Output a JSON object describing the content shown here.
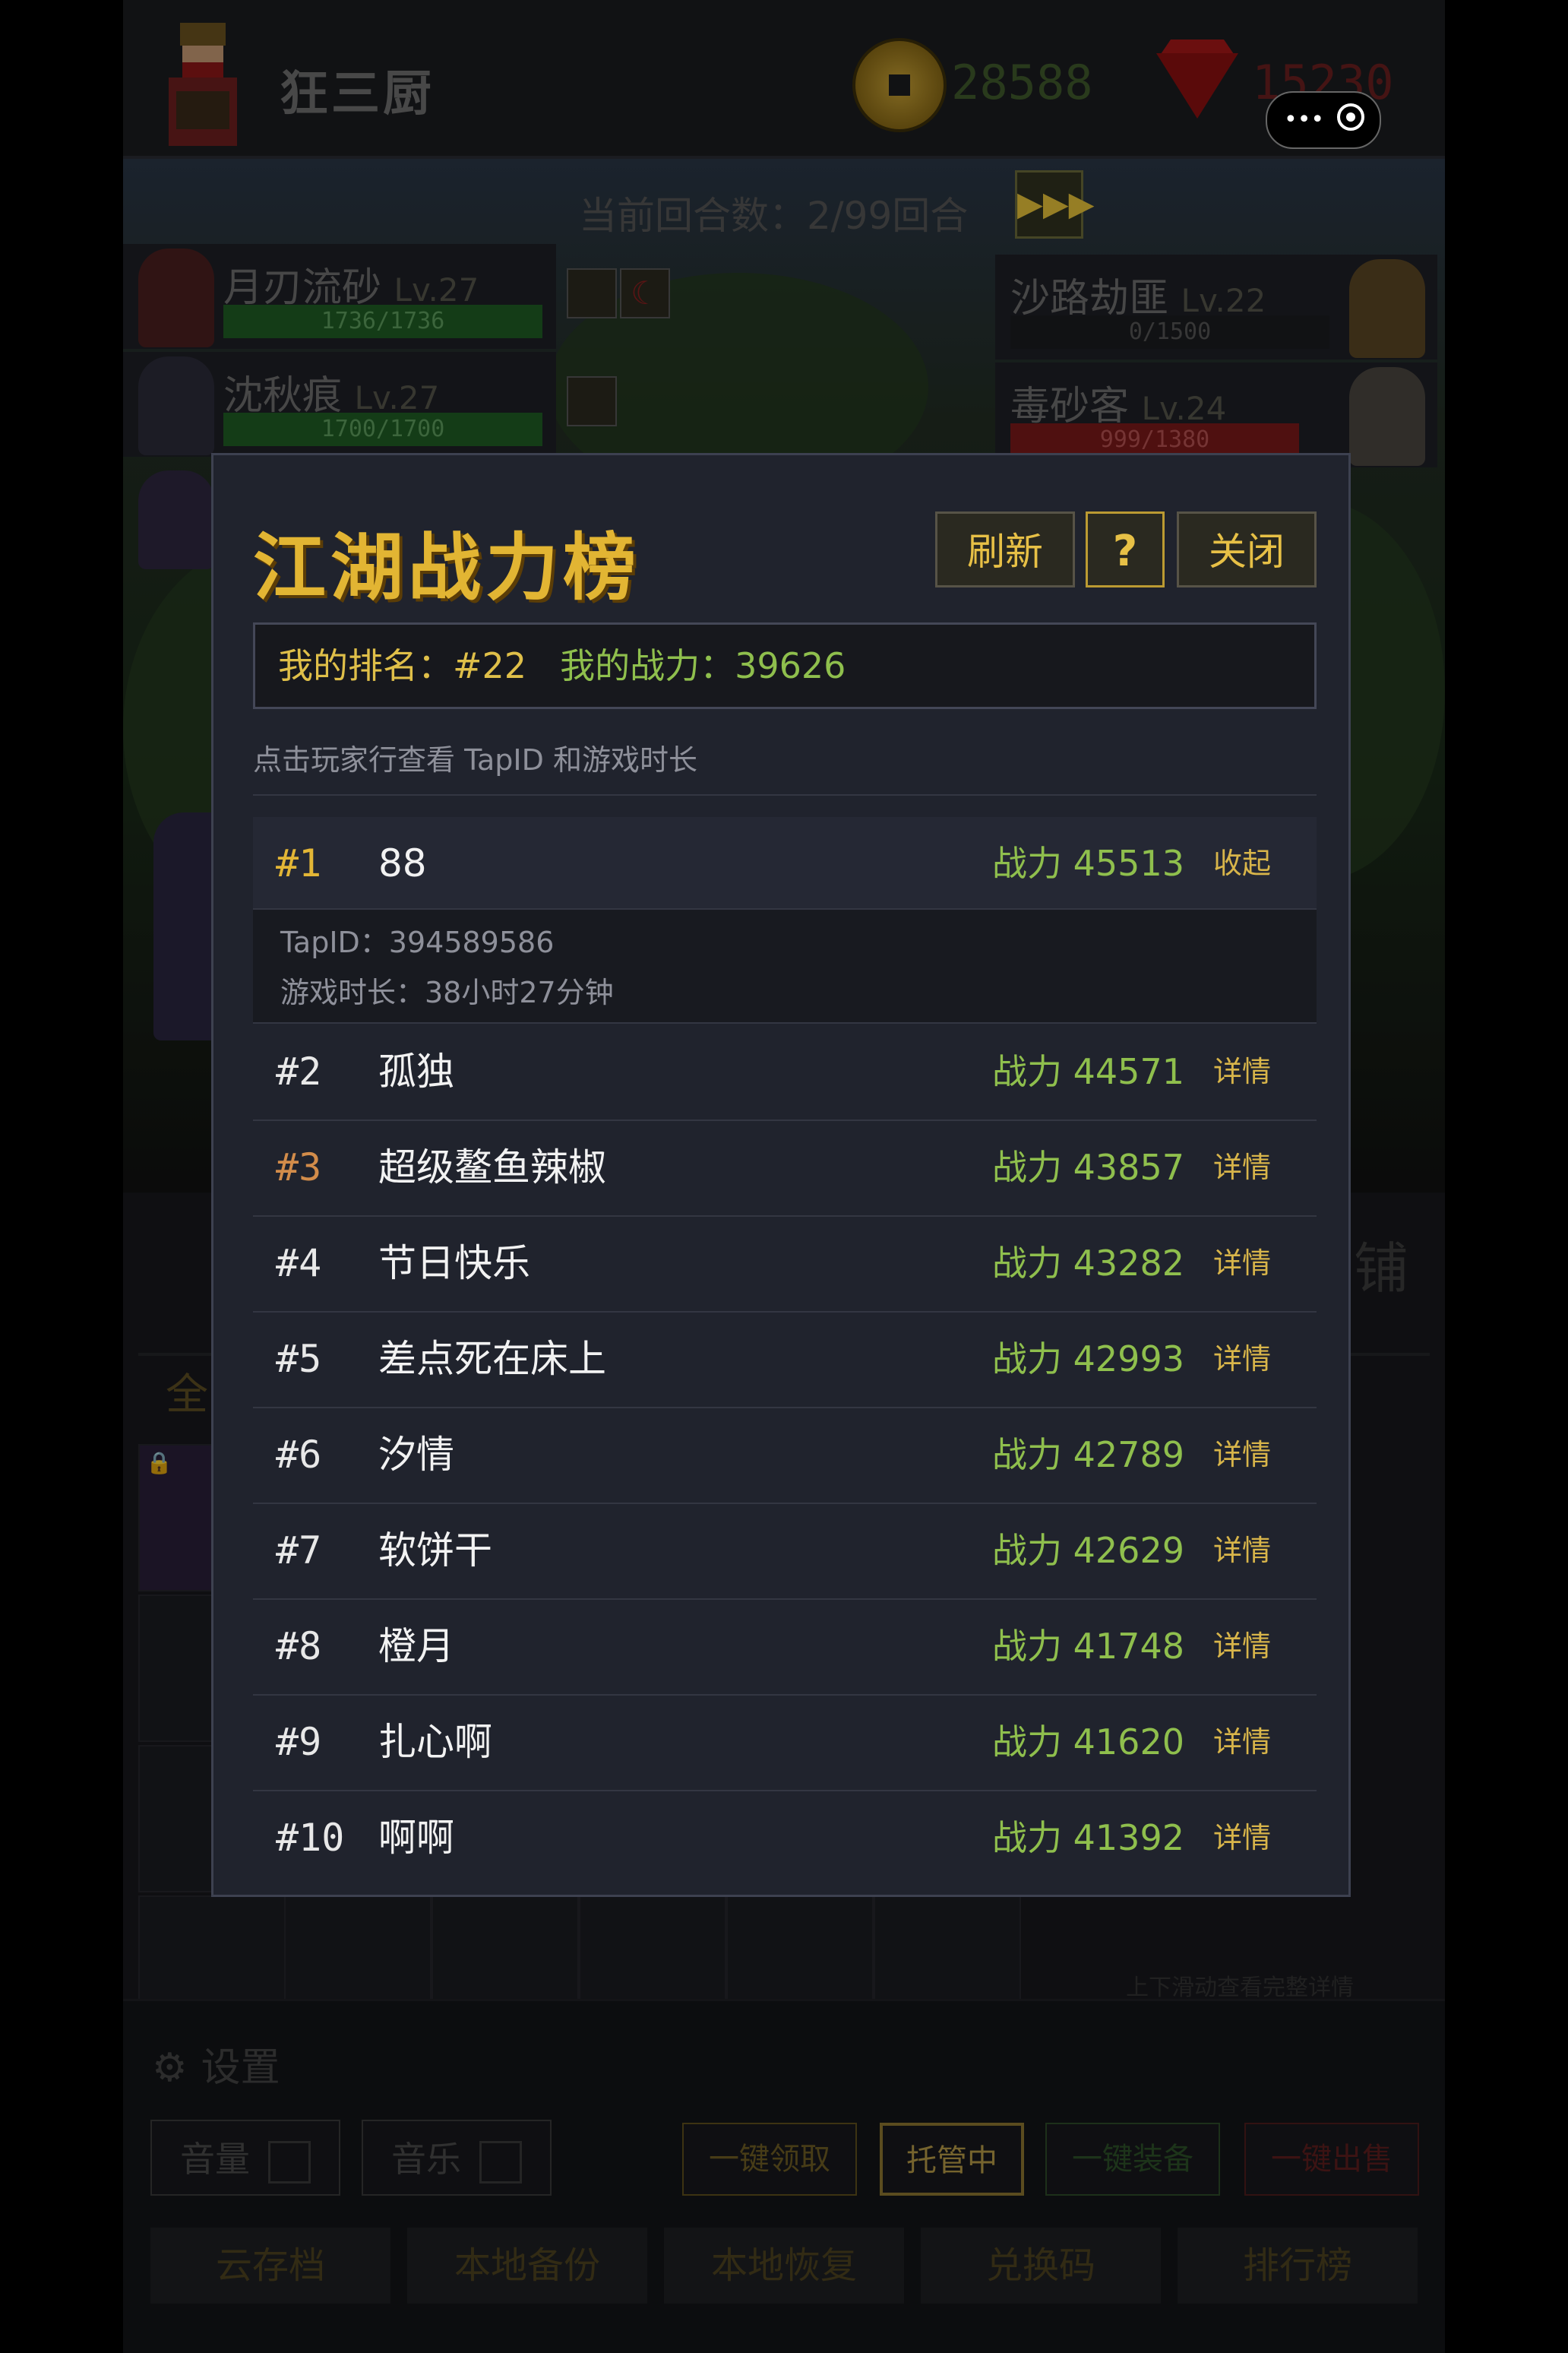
{
  "header": {
    "player_name": "狂三厨",
    "coins": "28588",
    "gems": "15230"
  },
  "battle": {
    "round_text": "当前回合数：2/99回合",
    "fast_forward": "▶▶▶",
    "allies": [
      {
        "name": "月刃流砂",
        "level": "Lv.27",
        "hp": "1736/1736"
      },
      {
        "name": "沈秋痕",
        "level": "Lv.27",
        "hp": "1700/1700"
      }
    ],
    "enemies": [
      {
        "name": "沙路劫匪",
        "level": "Lv.22",
        "hp": "0/1500"
      },
      {
        "name": "毒砂客",
        "level": "Lv.24",
        "hp": "999/1380"
      }
    ]
  },
  "lower": {
    "tab_label": "全",
    "shop_label": "铺",
    "scroll_hint": "上下滑动查看完整详情"
  },
  "settings": {
    "title": "设置",
    "volume": "音量",
    "music": "音乐",
    "auto_collect": "一键领取",
    "auto_manage": "托管中",
    "auto_equip": "一键装备",
    "auto_sell": "一键出售",
    "cloud_save": "云存档",
    "local_backup": "本地备份",
    "local_restore": "本地恢复",
    "redeem_code": "兑换码",
    "leaderboard": "排行榜"
  },
  "modal": {
    "title": "江湖战力榜",
    "refresh": "刷新",
    "help": "?",
    "close": "关闭",
    "my_rank": "我的排名：#22",
    "my_power": "我的战力：39626",
    "hint": "点击玩家行查看 TapID 和游戏时长",
    "expanded": {
      "tapid": "TapID：394589586",
      "playtime": "游戏时长：38小时27分钟"
    },
    "rows": [
      {
        "rank": "#1",
        "name": "88",
        "power": "战力 45513",
        "action": "收起"
      },
      {
        "rank": "#2",
        "name": "孤独",
        "power": "战力 44571",
        "action": "详情"
      },
      {
        "rank": "#3",
        "name": "超级鳌鱼辣椒",
        "power": "战力 43857",
        "action": "详情"
      },
      {
        "rank": "#4",
        "name": "节日快乐",
        "power": "战力 43282",
        "action": "详情"
      },
      {
        "rank": "#5",
        "name": "差点死在床上",
        "power": "战力 42993",
        "action": "详情"
      },
      {
        "rank": "#6",
        "name": "汐情",
        "power": "战力 42789",
        "action": "详情"
      },
      {
        "rank": "#7",
        "name": "软饼干",
        "power": "战力 42629",
        "action": "详情"
      },
      {
        "rank": "#8",
        "name": "橙月",
        "power": "战力 41748",
        "action": "详情"
      },
      {
        "rank": "#9",
        "name": "扎心啊",
        "power": "战力 41620",
        "action": "详情"
      },
      {
        "rank": "#10",
        "name": "啊啊",
        "power": "战力 41392",
        "action": "详情"
      }
    ]
  }
}
